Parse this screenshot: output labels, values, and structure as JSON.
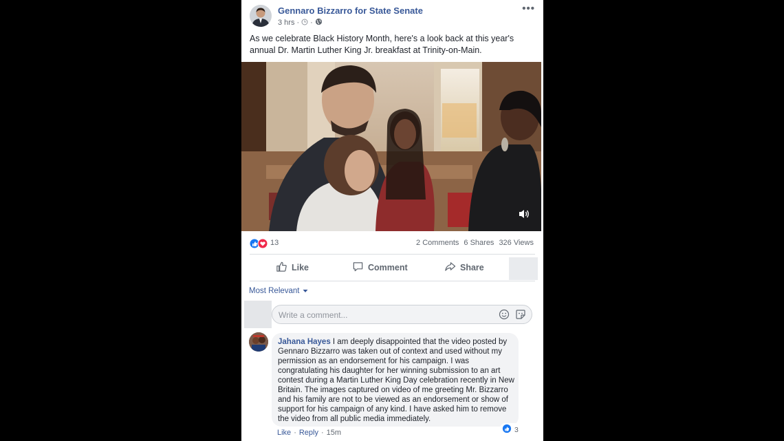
{
  "post": {
    "author": "Gennaro Bizzarro for State Senate",
    "time": "3 hrs",
    "meta_separator": "·",
    "text": "As we celebrate Black History Month, here's a look back at this year's annual Dr. Martin Luther King Jr. breakfast at Trinity-on-Main.",
    "more_icon": "•••"
  },
  "stats": {
    "reactions_count": "13",
    "comments": "2 Comments",
    "shares": "6 Shares",
    "views": "326 Views"
  },
  "actions": {
    "like": "Like",
    "comment": "Comment",
    "share": "Share"
  },
  "comments_section": {
    "sort_label": "Most Relevant",
    "write_placeholder": "Write a comment...",
    "comment": {
      "name": "Jahana Hayes",
      "text": "I am deeply disappointed that the video posted by Gennaro Bizzarro was taken out of context and used without my permission as an endorsement for his campaign. I was congratulating his daughter for her winning submission to an art contest during a Martin Luther King Day celebration recently in New Britain. The images captured on video of me greeting Mr. Bizzarro and his family are not to be viewed as an endorsement or show of support for his campaign of any kind. I have asked him to remove the video from all public media immediately.",
      "reaction_count": "3",
      "like": "Like",
      "reply": "Reply",
      "separator": "·",
      "time": "15m"
    }
  },
  "colors": {
    "link": "#385898",
    "like_blue": "#1877f2",
    "love_red": "#f0284a"
  },
  "icons": [
    "clock-icon",
    "globe-icon",
    "more-icon",
    "volume-icon",
    "like-icon",
    "comment-icon",
    "share-icon",
    "chevron-down-icon",
    "emoji-icon",
    "sticker-icon"
  ]
}
